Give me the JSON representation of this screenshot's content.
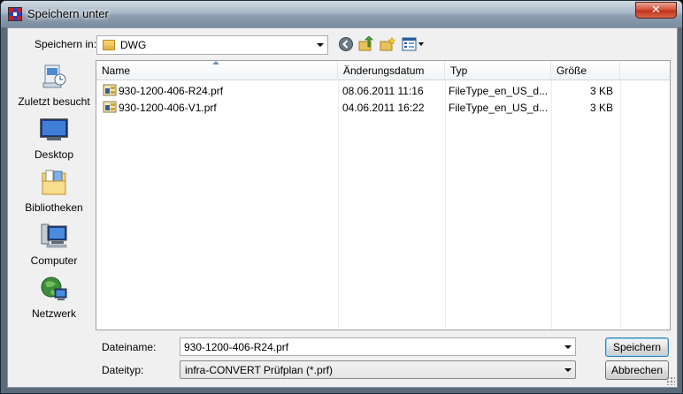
{
  "window": {
    "title": "Speichern unter",
    "close_label": "✕"
  },
  "location": {
    "label": "Speichern in:",
    "value": "DWG"
  },
  "toolbar": {
    "icons": [
      "back-icon",
      "up-folder-icon",
      "new-folder-icon",
      "views-menu-icon"
    ]
  },
  "places": [
    {
      "label": "Zuletzt besucht",
      "icon": "recent-places-icon"
    },
    {
      "label": "Desktop",
      "icon": "desktop-icon"
    },
    {
      "label": "Bibliotheken",
      "icon": "libraries-icon"
    },
    {
      "label": "Computer",
      "icon": "computer-icon"
    },
    {
      "label": "Netzwerk",
      "icon": "network-icon"
    }
  ],
  "columns": {
    "name": "Name",
    "date": "Änderungsdatum",
    "type": "Typ",
    "size": "Größe"
  },
  "files": [
    {
      "name": "930-1200-406-R24.prf",
      "date": "08.06.2011 11:16",
      "type": "FileType_en_US_d...",
      "size": "3 KB"
    },
    {
      "name": "930-1200-406-V1.prf",
      "date": "04.06.2011 16:22",
      "type": "FileType_en_US_d...",
      "size": "3 KB"
    }
  ],
  "filename": {
    "label": "Dateiname:",
    "value": "930-1200-406-R24.prf"
  },
  "filetype": {
    "label": "Dateityp:",
    "value": "infra-CONVERT Prüfplan (*.prf)"
  },
  "buttons": {
    "save": "Speichern",
    "cancel": "Abbrechen"
  }
}
